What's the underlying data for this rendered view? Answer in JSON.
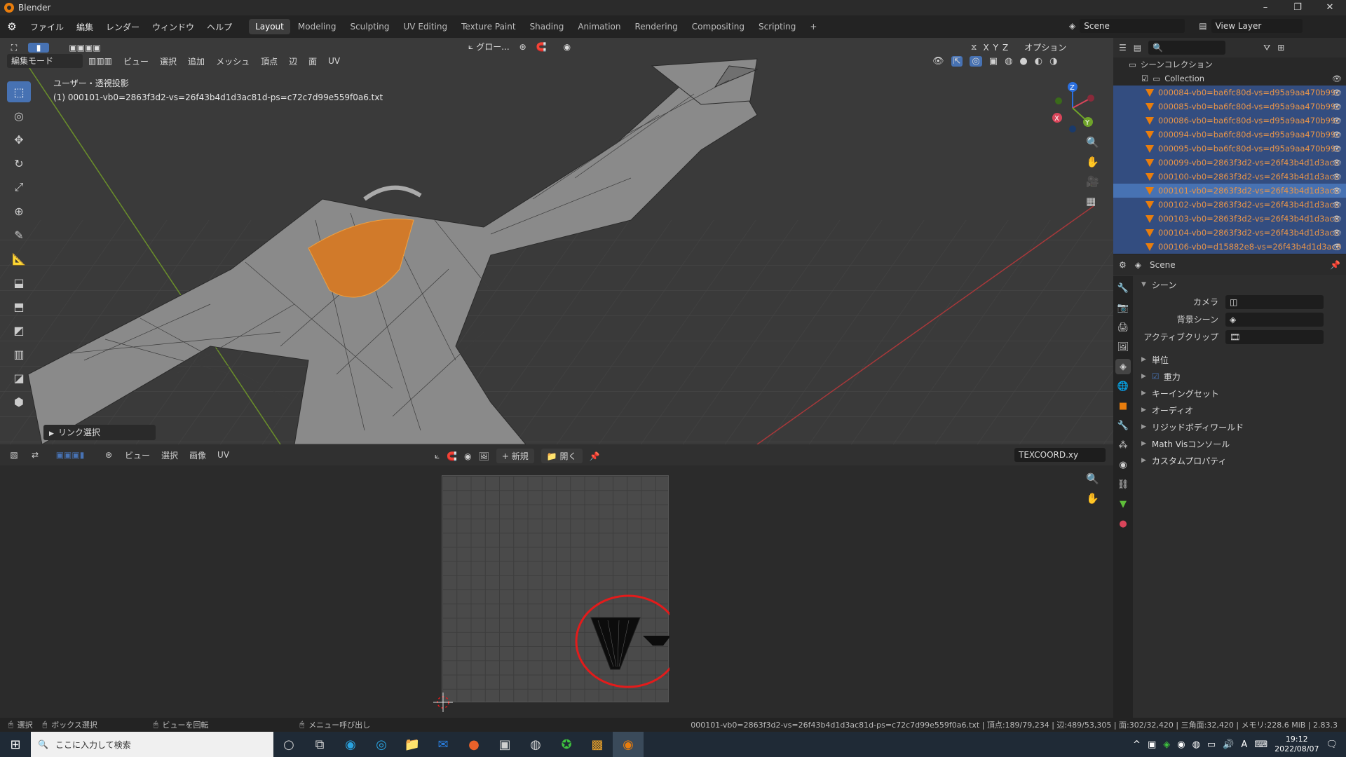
{
  "window": {
    "title": "Blender",
    "minimize": "–",
    "maximize": "❐",
    "close": "✕"
  },
  "menus": [
    "ファイル",
    "編集",
    "レンダー",
    "ウィンドウ",
    "ヘルプ"
  ],
  "workspace_tabs": [
    "Layout",
    "Modeling",
    "Sculpting",
    "UV Editing",
    "Texture Paint",
    "Shading",
    "Animation",
    "Rendering",
    "Compositing",
    "Scripting"
  ],
  "add_tab": "+",
  "scene_field": "Scene",
  "view_layer_field": "View Layer",
  "viewport": {
    "mode": "編集モード",
    "menus": [
      "ビュー",
      "選択",
      "追加",
      "メッシュ",
      "頂点",
      "辺",
      "面",
      "UV"
    ],
    "transform": "グロー...",
    "options": "オプション",
    "axes": [
      "X",
      "Y",
      "Z"
    ],
    "overlay_line1": "ユーザー・透視投影",
    "overlay_line2": "(1) 000101-vb0=2863f3d2-vs=26f43b4d1d3ac81d-ps=c72c7d99e559f0a6.txt",
    "last_op": "リンク選択",
    "gizmo": {
      "x": "X",
      "y": "Y",
      "z": "Z"
    }
  },
  "uv_editor": {
    "menus": [
      "ビュー",
      "選択",
      "画像",
      "UV"
    ],
    "new_btn": "新規",
    "open_btn": "開く",
    "uv_map": "TEXCOORD.xy"
  },
  "outliner": {
    "root": "シーンコレクション",
    "collection": "Collection",
    "items": [
      "000084-vb0=ba6fc80d-vs=d95a9aa470b99c",
      "000085-vb0=ba6fc80d-vs=d95a9aa470b99c",
      "000086-vb0=ba6fc80d-vs=d95a9aa470b99c",
      "000094-vb0=ba6fc80d-vs=d95a9aa470b99c",
      "000095-vb0=ba6fc80d-vs=d95a9aa470b99c",
      "000099-vb0=2863f3d2-vs=26f43b4d1d3ac8",
      "000100-vb0=2863f3d2-vs=26f43b4d1d3ac8",
      "000101-vb0=2863f3d2-vs=26f43b4d1d3ac8",
      "000102-vb0=2863f3d2-vs=26f43b4d1d3ac8",
      "000103-vb0=2863f3d2-vs=26f43b4d1d3ac8",
      "000104-vb0=2863f3d2-vs=26f43b4d1d3ac8",
      "000106-vb0=d15882e8-vs=26f43b4d1d3ac8"
    ],
    "active_index": 7
  },
  "properties": {
    "context": "Scene",
    "panel": "シーン",
    "camera_label": "カメラ",
    "bg_scene_label": "背景シーン",
    "active_clip_label": "アクティブクリップ",
    "subpanels": [
      "単位",
      "重力",
      "キーイングセット",
      "オーディオ",
      "リジッドボディワールド",
      "Math Visコンソール",
      "カスタムプロパティ"
    ]
  },
  "statusbar": {
    "select": "選択",
    "box_select": "ボックス選択",
    "rotate_view": "ビューを回転",
    "call_menu": "メニュー呼び出し",
    "info": "000101-vb0=2863f3d2-vs=26f43b4d1d3ac81d-ps=c72c7d99e559f0a6.txt | 頂点:189/79,234 | 辺:489/53,305 | 面:302/32,420 | 三角面:32,420 | メモリ:228.6 MiB | 2.83.3"
  },
  "taskbar": {
    "search_placeholder": "ここに入力して検索",
    "time": "19:12",
    "date": "2022/08/07",
    "ime": "A"
  },
  "colors": {
    "accent": "#4772b3",
    "orange": "#e87d0d",
    "highlight_circle": "#e31b1b"
  }
}
